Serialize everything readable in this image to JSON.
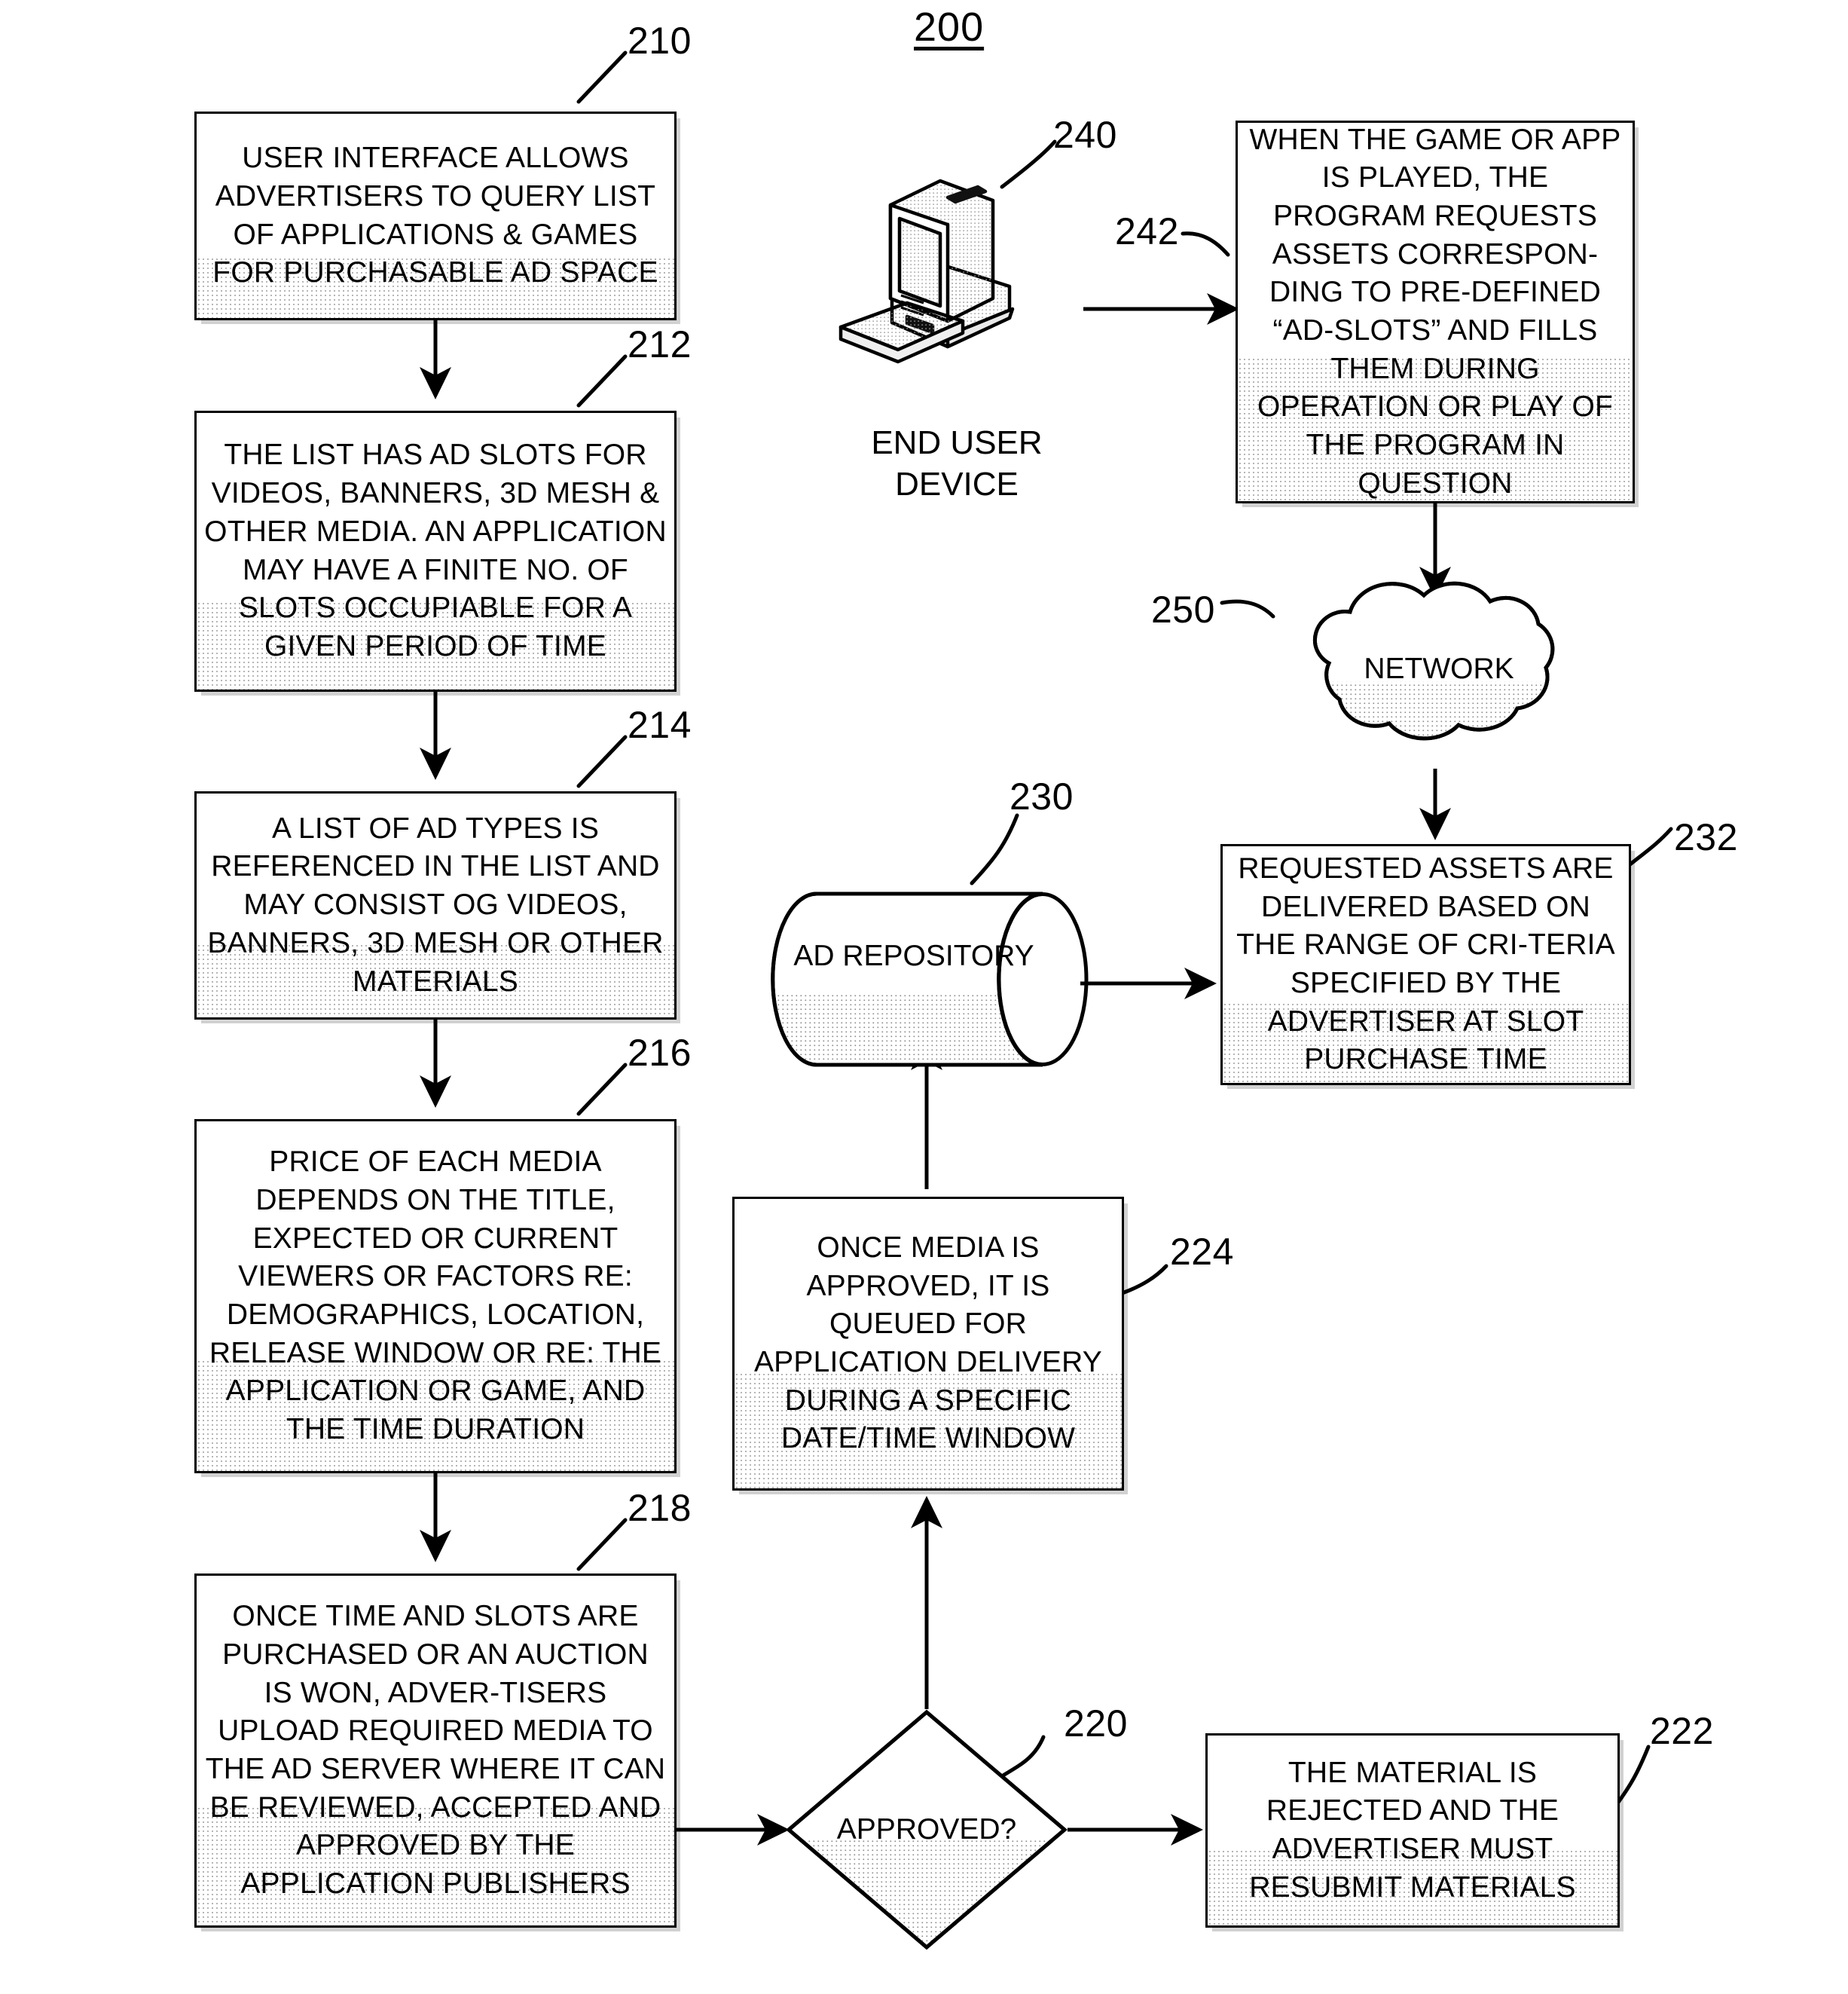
{
  "figure": {
    "number": "200"
  },
  "boxes": {
    "b210": {
      "ref": "210",
      "text": "USER INTERFACE ALLOWS ADVERTISERS TO QUERY LIST OF APPLICATIONS & GAMES FOR PURCHASABLE AD SPACE"
    },
    "b212": {
      "ref": "212",
      "text": "THE LIST HAS AD SLOTS FOR VIDEOS, BANNERS, 3D MESH & OTHER MEDIA.  AN APPLICATION MAY HAVE A FINITE NO. OF SLOTS OCCUPIABLE FOR A GIVEN PERIOD OF TIME"
    },
    "b214": {
      "ref": "214",
      "text": "A LIST OF AD TYPES IS REFERENCED IN THE LIST AND MAY CONSIST OG VIDEOS, BANNERS, 3D MESH OR OTHER MATERIALS"
    },
    "b216": {
      "ref": "216",
      "text": "PRICE OF EACH MEDIA DEPENDS ON THE TITLE, EXPECTED OR CURRENT VIEWERS OR FACTORS RE: DEMOGRAPHICS, LOCATION, RELEASE WINDOW OR RE: THE APPLICATION OR GAME, AND THE TIME DURATION"
    },
    "b218": {
      "ref": "218",
      "text": "ONCE TIME AND SLOTS ARE PURCHASED OR AN AUCTION IS WON, ADVER-TISERS UPLOAD REQUIRED MEDIA TO THE AD SERVER WHERE IT CAN BE REVIEWED, ACCEPTED AND APPROVED BY THE APPLICATION PUBLISHERS"
    },
    "b220": {
      "ref": "220",
      "text": "APPROVED?"
    },
    "b222": {
      "ref": "222",
      "text": "THE MATERIAL IS REJECTED AND THE ADVERTISER MUST RESUBMIT MATERIALS"
    },
    "b224": {
      "ref": "224",
      "text": "ONCE MEDIA IS APPROVED, IT IS QUEUED FOR APPLICATION DELIVERY DURING A SPECIFIC DATE/TIME WINDOW"
    },
    "b230": {
      "ref": "230",
      "text": "AD REPOSITORY"
    },
    "b232": {
      "ref": "232",
      "text": "REQUESTED ASSETS ARE DELIVERED BASED ON THE RANGE OF CRI-TERIA SPECIFIED BY THE ADVERTISER AT SLOT PURCHASE TIME"
    },
    "b240": {
      "ref": "240",
      "caption": "END USER\nDEVICE"
    },
    "b242": {
      "ref": "242",
      "text": "WHEN THE GAME OR APP IS PLAYED, THE PROGRAM REQUESTS ASSETS CORRESPON-DING TO PRE-DEFINED “AD-SLOTS” AND FILLS THEM DURING OPERATION OR PLAY OF THE PROGRAM IN QUESTION"
    },
    "b250": {
      "ref": "250",
      "text": "NETWORK"
    }
  },
  "colors": {
    "stroke": "#000000",
    "fill": "#ffffff",
    "shade": "#8a8a8a"
  }
}
